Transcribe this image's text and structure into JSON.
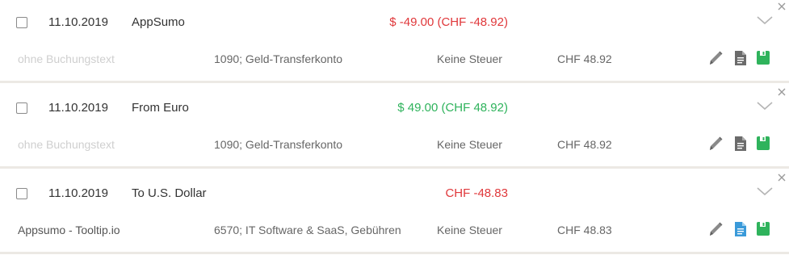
{
  "transactions": [
    {
      "date": "11.10.2019",
      "description": "AppSumo",
      "amount": "$ -49.00 (CHF -48.92)",
      "amount_type": "negative",
      "booking_text": "ohne Buchungstext",
      "booking_text_placeholder": true,
      "account": "1090; Geld-Transferkonto",
      "tax": "Keine Steuer",
      "chf_amount": "CHF 48.92",
      "doc_icon_color": "#6b6b6b"
    },
    {
      "date": "11.10.2019",
      "description": "From Euro",
      "amount": "$ 49.00 (CHF 48.92)",
      "amount_type": "positive",
      "booking_text": "ohne Buchungstext",
      "booking_text_placeholder": true,
      "account": "1090; Geld-Transferkonto",
      "tax": "Keine Steuer",
      "chf_amount": "CHF 48.92",
      "doc_icon_color": "#6b6b6b"
    },
    {
      "date": "11.10.2019",
      "description": "To U.S. Dollar",
      "amount": "CHF -48.83",
      "amount_type": "negative",
      "booking_text": "Appsumo - Tooltip.io",
      "booking_text_placeholder": false,
      "account": "6570; IT Software & SaaS, Gebühren",
      "tax": "Keine Steuer",
      "chf_amount": "CHF 48.83",
      "doc_icon_color": "#3a9ad9"
    }
  ],
  "icons": {
    "edit": "pencil-icon",
    "document": "document-icon",
    "save": "save-icon",
    "expand": "chevron-down-icon",
    "close": "close-icon"
  },
  "colors": {
    "negative": "#e0383b",
    "positive": "#2fb35c",
    "save_green": "#2fb35c",
    "separator": "#ece9e4"
  }
}
